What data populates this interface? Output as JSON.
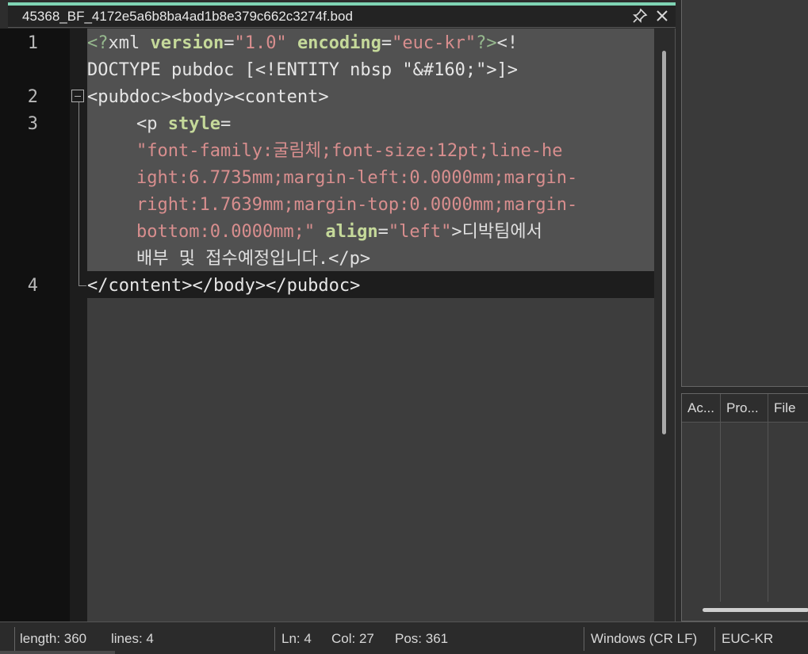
{
  "tab": {
    "title": "45368_BF_4172e5a6b8ba4ad1b8e379c662c3274f.bod",
    "pin_icon": "pin-icon",
    "close_icon": "close-icon"
  },
  "editor": {
    "line_numbers": [
      "1",
      "2",
      "3",
      "4"
    ],
    "line1a": {
      "t1": "<?",
      "t2": "xml ",
      "a1": "version",
      "t3": "=",
      "v1": "\"1.0\"",
      "t4": " ",
      "a2": "encoding",
      "t5": "=",
      "v2": "\"euc-kr\"",
      "t6": "?>",
      "t7": "<!"
    },
    "line1b": "DOCTYPE pubdoc [<!ENTITY nbsp \"&#160;\">]>",
    "line2": "<pubdoc><body><content>",
    "line3a": {
      "t1": "<p ",
      "a1": "style",
      "t2": "="
    },
    "line3b": "\"font-family:굴림체;font-size:12pt;line-he",
    "line3c": "ight:6.7735mm;margin-left:0.0000mm;margin-",
    "line3d": "right:1.7639mm;margin-top:0.0000mm;margin-",
    "line3e": {
      "v1": "bottom:0.0000mm;\"",
      "t1": " ",
      "a1": "align",
      "t2": "=",
      "v2": "\"left\"",
      "t3": ">",
      "t4": "디박팀에서"
    },
    "line3f": {
      "t1": "배부 및 접수예정입니다.",
      "t2": "</p>"
    },
    "line4": "</content></body></pubdoc>"
  },
  "side_panel": {
    "columns": [
      "Ac...",
      "Pro...",
      "File"
    ]
  },
  "status": {
    "length": "length: 360",
    "lines": "lines: 4",
    "ln": "Ln: 4",
    "col": "Col: 27",
    "pos": "Pos: 361",
    "eol": "Windows (CR LF)",
    "encoding": "EUC-KR"
  }
}
